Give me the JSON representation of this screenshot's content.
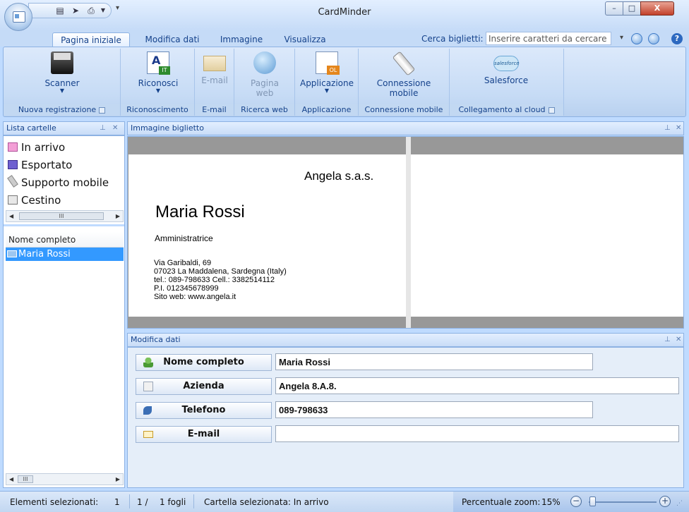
{
  "window": {
    "title": "CardMinder",
    "minimize_label": "–",
    "maximize_label": "□",
    "close_label": "X"
  },
  "tabs": [
    {
      "label": "Pagina iniziale",
      "active": true
    },
    {
      "label": "Modifica dati"
    },
    {
      "label": "Immagine"
    },
    {
      "label": "Visualizza"
    }
  ],
  "search": {
    "label": "Cerca biglietti:",
    "placeholder": "Inserire caratteri da cercare"
  },
  "ribbon": {
    "groups": [
      {
        "label": "Nuova registrazione",
        "buttons": [
          {
            "label": "Scanner",
            "icon": "scanner-icon"
          }
        ]
      },
      {
        "label": "Riconoscimento",
        "buttons": [
          {
            "label": "Riconosci",
            "icon": "ocr-icon"
          }
        ]
      },
      {
        "label": "E-mail",
        "buttons": [
          {
            "label": "E-mail",
            "icon": "mail-icon",
            "disabled": true
          }
        ]
      },
      {
        "label": "Ricerca web",
        "buttons": [
          {
            "label": "Pagina web",
            "icon": "globe-icon",
            "disabled": true
          }
        ]
      },
      {
        "label": "Applicazione",
        "buttons": [
          {
            "label": "Applicazione",
            "icon": "outlook-icon"
          }
        ]
      },
      {
        "label": "Connessione mobile",
        "buttons": [
          {
            "label": "Connessione mobile",
            "icon": "usb-icon"
          }
        ]
      },
      {
        "label": "Collegamento al cloud",
        "buttons": [
          {
            "label": "Salesforce",
            "icon": "salesforce-icon"
          }
        ]
      }
    ],
    "web_label_line1": "Pagina",
    "web_label_line2": "web",
    "mobile_label_line1": "Connessione",
    "mobile_label_line2": "mobile",
    "salesforce_logo_text": "salesforce"
  },
  "folders_panel": {
    "title": "Lista cartelle",
    "items": [
      {
        "label": "In arrivo",
        "icon": "inbox-folder-icon"
      },
      {
        "label": "Esportato",
        "icon": "exported-icon"
      },
      {
        "label": "Supporto mobile",
        "icon": "mobile-icon"
      },
      {
        "label": "Cestino",
        "icon": "trash-icon"
      }
    ]
  },
  "list": {
    "column_header": "Nome completo",
    "rows": [
      "Maria Rossi"
    ]
  },
  "image_panel": {
    "title": "Immagine biglietto"
  },
  "card": {
    "company": "Angela s.a.s.",
    "name": "Maria Rossi",
    "role": "Amministratrice",
    "address_lines": [
      "Via Garibaldi, 69",
      "07023 La Maddalena, Sardegna (Italy)",
      "tel.: 089-798633   Cell.: 3382514112",
      "P.I. 012345678999",
      "Sito web: www.angela.it"
    ]
  },
  "edit_panel": {
    "title": "Modifica dati",
    "fields": [
      {
        "label": "Nome completo",
        "value": "Maria Rossi",
        "icon": "person-icon"
      },
      {
        "label": "Azienda",
        "value": "Angela 8.A.8.",
        "icon": "building-icon"
      },
      {
        "label": "Telefono",
        "value": "089-798633",
        "icon": "phone-icon"
      },
      {
        "label": "E-mail",
        "value": "",
        "icon": "envelope-icon"
      }
    ]
  },
  "statusbar": {
    "selected_label": "Elementi selezionati:",
    "selected_count": "1",
    "page": "1 /",
    "sheets": "1 fogli",
    "folder": "Cartella selezionata: In arrivo",
    "zoom_label": "Percentuale zoom:",
    "zoom_value": "15%"
  }
}
